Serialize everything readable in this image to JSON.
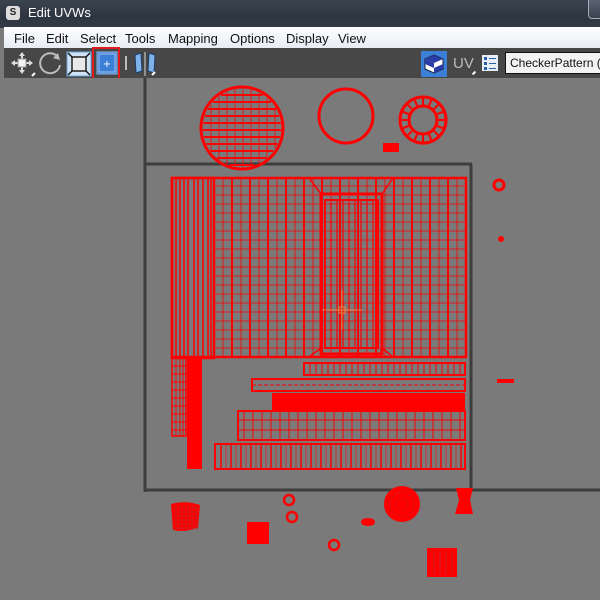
{
  "window": {
    "title": "Edit UVWs",
    "app_icon": "3ds-max-icon"
  },
  "menu": [
    {
      "label": "File"
    },
    {
      "label": "Edit"
    },
    {
      "label": "Select"
    },
    {
      "label": "Tools"
    },
    {
      "label": "Mapping"
    },
    {
      "label": "Options"
    },
    {
      "label": "Display"
    },
    {
      "label": "View"
    }
  ],
  "toolbar": {
    "tools": [
      {
        "name": "move-tool",
        "icon": "move-icon",
        "active": false
      },
      {
        "name": "rotate-tool",
        "icon": "rotate-icon",
        "active": false
      },
      {
        "name": "scale-tool",
        "icon": "scale-icon",
        "active": false
      },
      {
        "name": "freeform-tool",
        "icon": "freeform-icon",
        "active": true,
        "highlighted": true
      },
      {
        "name": "mirror-tool",
        "icon": "mirror-icon",
        "active": false
      }
    ],
    "uv_label": "UV",
    "checker_icon": "checker-map-icon",
    "options_icon": "list-options-icon",
    "texture_dropdown": "CheckerPattern  ( C"
  },
  "colors": {
    "uv_wire": "#ff0000",
    "viewport_bg": "#7a7a7a",
    "frame": "#3e3e3e",
    "highlight": "#e11b1b",
    "active_tool": "#3b7fd6"
  }
}
